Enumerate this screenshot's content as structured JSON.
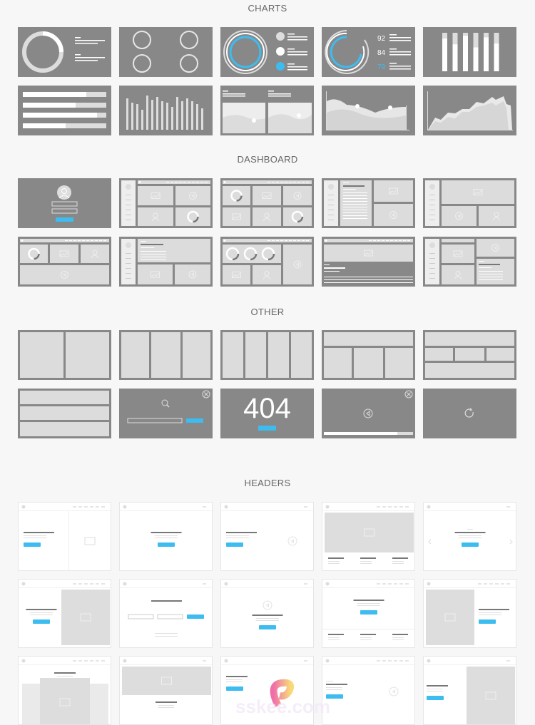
{
  "sections": {
    "charts": "CHARTS",
    "dashboard": "DASHBOARD",
    "other": "OTHER",
    "headers": "HEADERS"
  },
  "charts": {
    "radial_values": [
      "92",
      "84",
      "79"
    ],
    "bar_fills_pct": [
      85,
      70,
      92,
      62,
      88,
      72
    ]
  },
  "other": {
    "error_code": "404"
  },
  "colors": {
    "accent": "#3dbcf0",
    "card_dark": "#888888",
    "panel_light": "#dcdcdc",
    "background": "#f7f7f7"
  },
  "watermark": "sskee.com"
}
